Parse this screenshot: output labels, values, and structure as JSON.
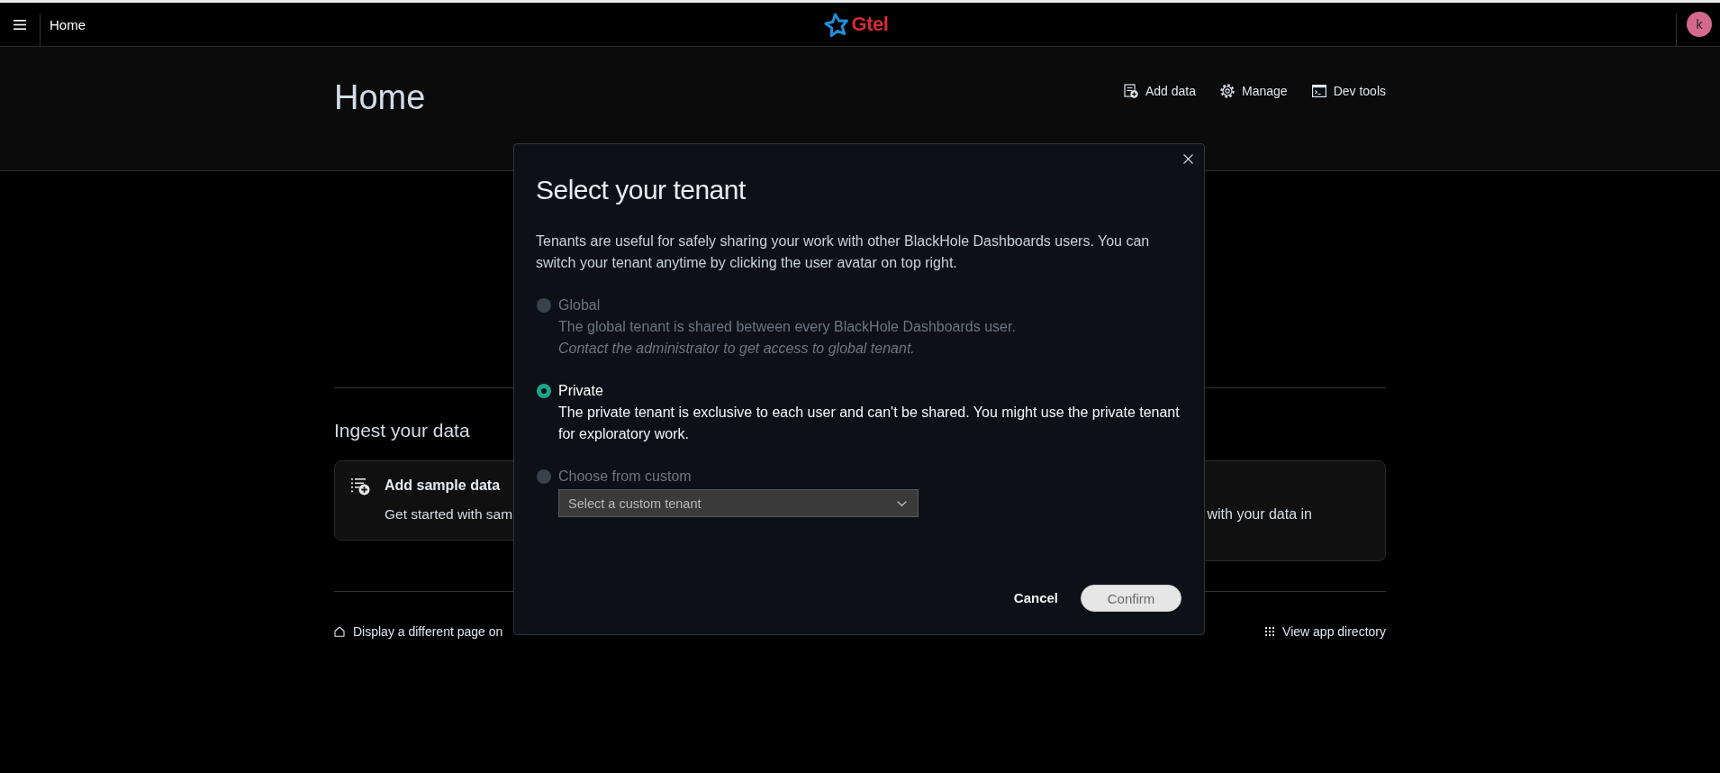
{
  "top_bar": {
    "page_title": "Home",
    "logo_text": "Gtel",
    "avatar_initial": "k"
  },
  "header": {
    "title": "Home",
    "actions": [
      {
        "label": "Add data"
      },
      {
        "label": "Manage"
      },
      {
        "label": "Dev tools"
      }
    ]
  },
  "ingest": {
    "heading": "Ingest your data",
    "cards": [
      {
        "title": "Add sample data",
        "text": "Get started with sam"
      },
      {
        "text": "with your data in"
      }
    ]
  },
  "footer_links": [
    {
      "label": "Display a different page on"
    },
    {
      "label": "View app directory"
    }
  ],
  "dialog": {
    "title": "Select your tenant",
    "intro": "Tenants are useful for safely sharing your work with other BlackHole Dashboards users. You can switch your tenant anytime by clicking the user avatar on top right.",
    "options": [
      {
        "kind": "plain",
        "label": "Global",
        "description": "The global tenant is shared between every BlackHole Dashboards user.",
        "note": "Contact the administrator to get access to global tenant.",
        "selected": false,
        "disabled": true
      },
      {
        "kind": "plain",
        "label": "Private",
        "description": "The private tenant is exclusive to each user and can't be shared. You might use the private tenant for exploratory work.",
        "selected": true,
        "disabled": false
      },
      {
        "kind": "select",
        "label": "Choose from custom",
        "select": {
          "placeholder": "Select a custom tenant"
        },
        "selected": false,
        "disabled": true
      }
    ],
    "cancel_button": "Cancel",
    "confirm_button": "Confirm"
  }
}
